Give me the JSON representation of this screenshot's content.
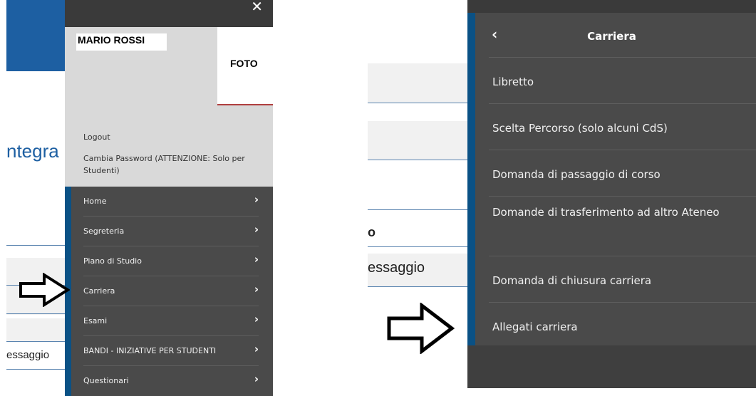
{
  "left": {
    "page_title_fragment": "ntegra",
    "message_fragment": "essaggio",
    "close_icon": "close-icon",
    "user": {
      "name": "MARIO ROSSI",
      "photo_label": "FOTO",
      "logout": "Logout",
      "change_password": "Cambia Password (ATTENZIONE: Solo per Studenti)"
    },
    "menu_items": [
      {
        "label": "Home"
      },
      {
        "label": "Segreteria"
      },
      {
        "label": "Piano di Studio"
      },
      {
        "label": "Carriera"
      },
      {
        "label": "Esami"
      },
      {
        "label": "BANDI - INIZIATIVE PER STUDENTI"
      },
      {
        "label": "Questionari"
      }
    ],
    "chevron": "›"
  },
  "right": {
    "bg_fragment_bold": "o",
    "message_fragment": "essaggio",
    "back_glyph": "‹",
    "title": "Carriera",
    "items": [
      {
        "label": "Libretto"
      },
      {
        "label": "Scelta Percorso (solo alcuni CdS)"
      },
      {
        "label": "Domanda di passaggio di corso"
      },
      {
        "label": "Domande di trasferimento ad altro Ateneo"
      },
      {
        "label": "Domanda di chiusura carriera"
      },
      {
        "label": "Allegati carriera"
      }
    ]
  },
  "colors": {
    "menu_bg": "#4a4a4a",
    "accent_blue": "#0a5185",
    "header_blue": "#1d5fa2"
  }
}
